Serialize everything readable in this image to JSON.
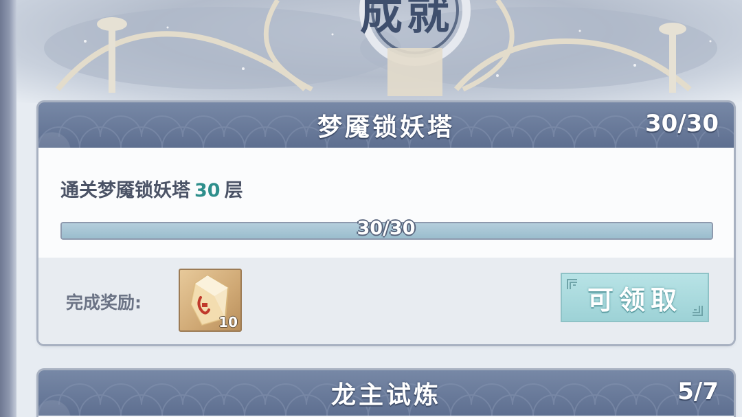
{
  "banner": {
    "title": "成就"
  },
  "achievements": [
    {
      "title": "梦魇锁妖塔",
      "count": "30/30",
      "task_prefix": "通关梦魇锁妖塔",
      "task_number": "30",
      "task_suffix": "层",
      "progress_text": "30/30",
      "progress_fraction": 1.0,
      "reward_label": "完成奖励:",
      "reward_icon": "crystal-shard-icon",
      "reward_quantity": "10",
      "claim_label": "可领取"
    },
    {
      "title": "龙主试炼",
      "count": "5/7"
    }
  ],
  "colors": {
    "header_bg": "#6a7b9a",
    "highlight_number": "#2e8f8c",
    "claim_button": "#a9dade",
    "progress_fill": "#a6c5d3"
  }
}
